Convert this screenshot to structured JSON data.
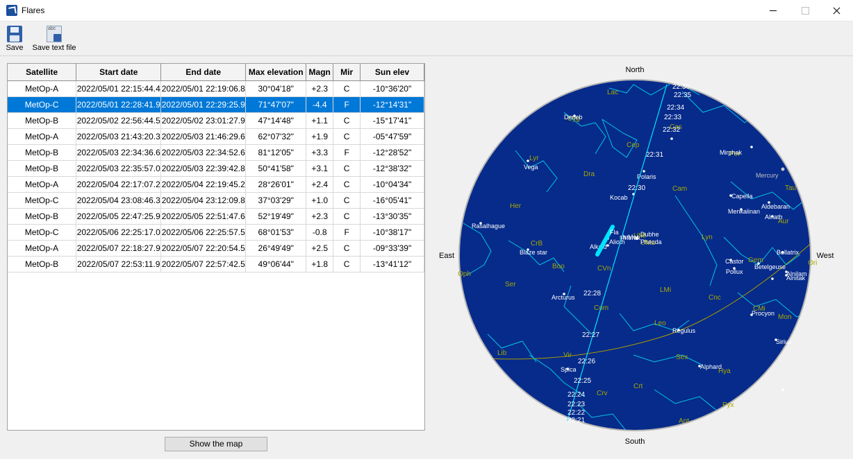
{
  "window": {
    "title": "Flares"
  },
  "toolbar": {
    "save_label": "Save",
    "save_text_label": "Save text file"
  },
  "table": {
    "columns": [
      "Satellite",
      "Start date",
      "End date",
      "Max elevation",
      "Magn",
      "Mir",
      "Sun elev"
    ],
    "selected_index": 1,
    "rows": [
      [
        "MetOp-A",
        "2022/05/01 22:15:44.4",
        "2022/05/01 22:19:06.8",
        "30°04'18\"",
        "+2.3",
        "C",
        "-10°36'20\""
      ],
      [
        "MetOp-C",
        "2022/05/01 22:28:41.9",
        "2022/05/01 22:29:25.9",
        "71°47'07\"",
        "-4.4",
        "F",
        "-12°14'31\""
      ],
      [
        "MetOp-B",
        "2022/05/02 22:56:44.5",
        "2022/05/02 23:01:27.9",
        "47°14'48\"",
        "+1.1",
        "C",
        "-15°17'41\""
      ],
      [
        "MetOp-A",
        "2022/05/03 21:43:20.3",
        "2022/05/03 21:46:29.6",
        "62°07'32\"",
        "+1.9",
        "C",
        "-05°47'59\""
      ],
      [
        "MetOp-B",
        "2022/05/03 22:34:36.6",
        "2022/05/03 22:34:52.6",
        "81°12'05\"",
        "+3.3",
        "F",
        "-12°28'52\""
      ],
      [
        "MetOp-B",
        "2022/05/03 22:35:57.0",
        "2022/05/03 22:39:42.8",
        "50°41'58\"",
        "+3.1",
        "C",
        "-12°38'32\""
      ],
      [
        "MetOp-A",
        "2022/05/04 22:17:07.2",
        "2022/05/04 22:19:45.2",
        "28°26'01\"",
        "+2.4",
        "C",
        "-10°04'34\""
      ],
      [
        "MetOp-C",
        "2022/05/04 23:08:46.3",
        "2022/05/04 23:12:09.8",
        "37°03'29\"",
        "+1.0",
        "C",
        "-16°05'41\""
      ],
      [
        "MetOp-B",
        "2022/05/05 22:47:25.9",
        "2022/05/05 22:51:47.6",
        "52°19'49\"",
        "+2.3",
        "C",
        "-13°30'35\""
      ],
      [
        "MetOp-C",
        "2022/05/06 22:25:17.0",
        "2022/05/06 22:25:57.5",
        "68°01'53\"",
        "-0.8",
        "F",
        "-10°38'17\""
      ],
      [
        "MetOp-A",
        "2022/05/07 22:18:27.9",
        "2022/05/07 22:20:54.5",
        "26°49'49\"",
        "+2.5",
        "C",
        "-09°33'39\""
      ],
      [
        "MetOp-B",
        "2022/05/07 22:53:11.9",
        "2022/05/07 22:57:42.5",
        "49°06'44\"",
        "+1.8",
        "C",
        "-13°41'12\""
      ]
    ]
  },
  "show_map_label": "Show the map",
  "skymap": {
    "directions": {
      "north": "North",
      "south": "South",
      "east": "East",
      "west": "West"
    },
    "colors": {
      "sky": "#062b8a",
      "constellation": "#00c8e6",
      "constellation_label": "#a8a800",
      "star_label": "#ffffff",
      "track": "#00e5ff",
      "planet_label": "#c0c0c0"
    },
    "star_labels": [
      "Deneb",
      "Vega",
      "Polaris",
      "Kocab",
      "Rasalhague",
      "Blaze star",
      "Alkaid",
      "Alioth",
      "Dubhe",
      "Mirphak",
      "Capella",
      "Menkalinan",
      "Aldebaran",
      "Alnath",
      "Castor",
      "Pollux",
      "Betelgeuse",
      "Bellatrix",
      "Alnilam",
      "Alnitak",
      "Arcturus",
      "Procyon",
      "Regulus",
      "Sirius",
      "Spica",
      "Alphard",
      "Merak",
      "Phecda"
    ],
    "constellation_labels": [
      "Lac",
      "Cyg",
      "Lyr",
      "Cep",
      "Dra",
      "Cas",
      "Per",
      "Tau",
      "Her",
      "Cam",
      "UMi",
      "Lyn",
      "CrB",
      "Boo",
      "CVn",
      "UMa",
      "Aur",
      "Gem",
      "Ori",
      "Oph",
      "Ser",
      "LMi",
      "Com",
      "Cnc",
      "CMi",
      "Mon",
      "Leo",
      "Sex",
      "Lib",
      "Vir",
      "Crv",
      "Crt",
      "Hya",
      "Ant",
      "Pyx"
    ],
    "planet_labels": [
      "Mercury"
    ],
    "track_labels": [
      "22:36",
      "22:35",
      "22:34",
      "22:33",
      "22:32",
      "22:31",
      "22:30",
      "22:28",
      "22:27",
      "22:26",
      "22:25",
      "22:24",
      "22:23",
      "22:22",
      "22:21"
    ],
    "flare_labels": [
      "Fla",
      "sh",
      "Mer"
    ]
  }
}
